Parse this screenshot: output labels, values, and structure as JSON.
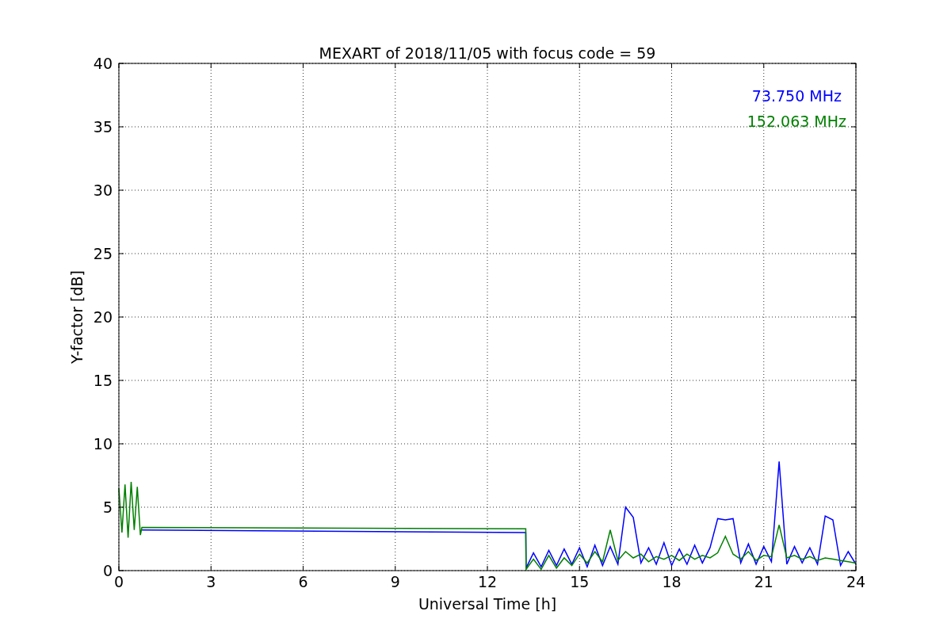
{
  "chart_data": {
    "type": "line",
    "title": "MEXART of 2018/11/05 with focus code = 59",
    "xlabel": "Universal Time [h]",
    "ylabel": "Y-factor [dB]",
    "x": [
      0,
      0.1,
      0.2,
      0.3,
      0.4,
      0.5,
      0.6,
      0.7,
      0.75,
      13.25,
      13.26,
      13.5,
      13.75,
      14,
      14.25,
      14.5,
      14.75,
      15,
      15.25,
      15.5,
      15.75,
      16,
      16.25,
      16.5,
      16.75,
      17,
      17.25,
      17.5,
      17.75,
      18,
      18.25,
      18.5,
      18.75,
      19,
      19.25,
      19.5,
      19.75,
      20,
      20.25,
      20.5,
      20.75,
      21,
      21.25,
      21.5,
      21.75,
      22,
      22.25,
      22.5,
      22.75,
      23,
      23.25,
      23.5,
      23.75,
      24
    ],
    "series": [
      {
        "name": "73.750 MHz",
        "color": "#0000ff",
        "values": [
          null,
          null,
          null,
          null,
          null,
          null,
          null,
          null,
          3.2,
          3.0,
          0.2,
          1.4,
          0.3,
          1.6,
          0.4,
          1.7,
          0.5,
          1.8,
          0.3,
          2.0,
          0.4,
          1.9,
          0.5,
          5.0,
          4.2,
          0.6,
          1.8,
          0.5,
          2.2,
          0.4,
          1.7,
          0.5,
          2.0,
          0.6,
          1.8,
          4.1,
          4.0,
          4.1,
          0.6,
          2.1,
          0.5,
          1.9,
          0.7,
          8.6,
          0.5,
          1.9,
          0.6,
          1.8,
          0.5,
          4.3,
          4.0,
          0.4,
          1.5,
          0.5
        ]
      },
      {
        "name": "152.063 MHz",
        "color": "#008000",
        "values": [
          6.5,
          3,
          6.8,
          2.6,
          7,
          3.2,
          6.6,
          2.8,
          3.4,
          3.3,
          0.1,
          0.9,
          0.1,
          1.2,
          0.2,
          1.0,
          0.4,
          1.3,
          0.6,
          1.5,
          0.7,
          3.2,
          0.8,
          1.5,
          1.0,
          1.3,
          0.7,
          1.1,
          0.9,
          1.2,
          0.8,
          1.3,
          0.9,
          1.2,
          1.0,
          1.4,
          2.7,
          1.3,
          0.9,
          1.5,
          0.8,
          1.2,
          1.1,
          3.6,
          1.0,
          1.2,
          0.9,
          1.1,
          0.8,
          1.0,
          0.9,
          0.8,
          0.7,
          0.6
        ]
      }
    ],
    "grid": true,
    "xlim": [
      0,
      24
    ],
    "ylim": [
      0,
      40
    ],
    "xticks": [
      0,
      3,
      6,
      9,
      12,
      15,
      18,
      21,
      24
    ],
    "yticks": [
      0,
      5,
      10,
      15,
      20,
      25,
      30,
      35,
      40
    ]
  }
}
